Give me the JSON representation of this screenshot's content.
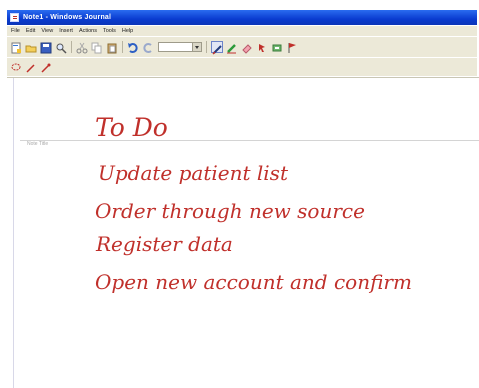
{
  "window": {
    "title": "Note1 - Windows Journal"
  },
  "menu": [
    "File",
    "Edit",
    "View",
    "Insert",
    "Actions",
    "Tools",
    "Help"
  ],
  "toolbar": {
    "color_value": ""
  },
  "note": {
    "title_hint": "Note Title",
    "heading": "To Do",
    "lines": [
      "Update patient list",
      "Order through new source",
      "Register data",
      "Open new account and confirm"
    ]
  },
  "colors": {
    "ink": "#c0302b",
    "titlebar": "#0a3cd0",
    "chrome": "#ece9d8"
  },
  "icons": {
    "toolbar_row_1": [
      "new-note-icon",
      "open-icon",
      "save-icon",
      "find-icon",
      "cut-icon",
      "copy-icon",
      "paste-icon",
      "undo-icon",
      "redo-icon",
      "pen-icon",
      "highlighter-icon",
      "eraser-icon",
      "selection-icon",
      "insert-space-icon",
      "flag-icon"
    ],
    "toolbar_row_2": [
      "lasso-icon",
      "pen-tool-icon",
      "eraser-tool-icon"
    ]
  }
}
